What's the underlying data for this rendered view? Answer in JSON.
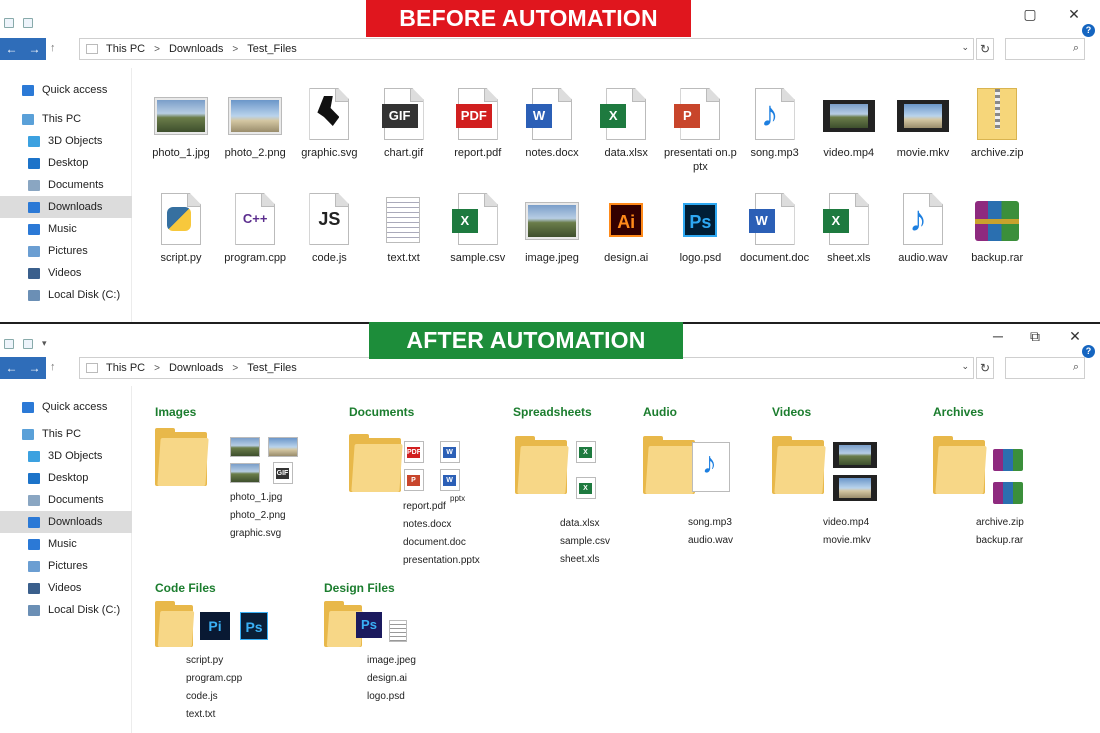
{
  "banners": {
    "before": "BEFORE AUTOMATION",
    "after": "AFTER AUTOMATION"
  },
  "window": {
    "help": "?",
    "minimize": "─",
    "maximize": "▢",
    "restore": "⧉",
    "close": "✕"
  },
  "nav": {
    "back": "←",
    "forward": "→",
    "up": "↑",
    "refresh": "↻",
    "search_icon": "⌕",
    "chevron": "⌄"
  },
  "breadcrumb": [
    "This PC",
    "Downloads",
    "Test_Files"
  ],
  "sidebar": [
    {
      "label": "Quick access",
      "icon": "star-icon",
      "color": "#2b79d6"
    },
    {
      "label": "This PC",
      "icon": "computer-icon",
      "color": "#5aa0d8"
    },
    {
      "label": "3D Objects",
      "icon": "cube-icon",
      "color": "#3ca1e0"
    },
    {
      "label": "Desktop",
      "icon": "desktop-icon",
      "color": "#1c73c9"
    },
    {
      "label": "Documents",
      "icon": "documents-icon",
      "color": "#8aa6c2"
    },
    {
      "label": "Downloads",
      "icon": "download-arrow-icon",
      "color": "#2b79d6"
    },
    {
      "label": "Music",
      "icon": "music-note-icon",
      "color": "#2b79d6"
    },
    {
      "label": "Pictures",
      "icon": "pictures-icon",
      "color": "#6b9ed2"
    },
    {
      "label": "Videos",
      "icon": "videos-icon",
      "color": "#3a5f8c"
    },
    {
      "label": "Local Disk (C:)",
      "icon": "disk-icon",
      "color": "#6b8fb5"
    }
  ],
  "before_files": [
    {
      "name": "photo_1.jpg",
      "kind": "land"
    },
    {
      "name": "photo_2.png",
      "kind": "sky"
    },
    {
      "name": "graphic.svg",
      "kind": "svg"
    },
    {
      "name": "chart.gif",
      "kind": "gif",
      "badge": "GIF",
      "color": "#333333"
    },
    {
      "name": "report.pdf",
      "kind": "badge",
      "badge": "PDF",
      "color": "#d11f1f"
    },
    {
      "name": "notes.docx",
      "kind": "badge",
      "badge": "W",
      "color": "#2b5fb6"
    },
    {
      "name": "data.xlsx",
      "kind": "badge",
      "badge": "X",
      "color": "#1e7a3f"
    },
    {
      "name": "presentati on.pptx",
      "kind": "badge",
      "badge": "P",
      "color": "#c8452b"
    },
    {
      "name": "song.mp3",
      "kind": "audio"
    },
    {
      "name": "video.mp4",
      "kind": "film"
    },
    {
      "name": "movie.mkv",
      "kind": "film2"
    },
    {
      "name": "archive.zip",
      "kind": "zip"
    },
    {
      "name": "script.py",
      "kind": "py"
    },
    {
      "name": "program.cpp",
      "kind": "cpp",
      "badge": "C++",
      "color": "#5b2d8e"
    },
    {
      "name": "code.js",
      "kind": "js",
      "badge": "JS",
      "color": "#222222"
    },
    {
      "name": "text.txt",
      "kind": "txt"
    },
    {
      "name": "sample.csv",
      "kind": "badge",
      "badge": "X",
      "color": "#1e7a3f"
    },
    {
      "name": "image.jpeg",
      "kind": "land"
    },
    {
      "name": "design.ai",
      "kind": "ai",
      "badge": "Ai",
      "color": "#ff8a1a"
    },
    {
      "name": "logo.psd",
      "kind": "ps",
      "badge": "Ps",
      "color": "#2ea8f2"
    },
    {
      "name": "document.doc",
      "kind": "badge",
      "badge": "W",
      "color": "#2b5fb6"
    },
    {
      "name": "sheet.xls",
      "kind": "badge",
      "badge": "X",
      "color": "#1e7a3f"
    },
    {
      "name": "audio.wav",
      "kind": "audio"
    },
    {
      "name": "backup.rar",
      "kind": "rar"
    }
  ],
  "groups": {
    "images": {
      "title": "Images",
      "files": [
        "photo_1.jpg",
        "photo_2.png",
        "graphic.svg"
      ]
    },
    "documents": {
      "title": "Documents",
      "files": [
        "report.pdf",
        "notes.docx",
        "document.doc",
        "presentation.pptx"
      ],
      "mini_badges": [
        "PDF",
        "W",
        "W"
      ],
      "pptx": "pptx"
    },
    "spreadsheets": {
      "title": "Spreadsheets",
      "files": [
        "data.xlsx",
        "sample.csv",
        "sheet.xls"
      ],
      "mini_badges": [
        "X",
        "X"
      ]
    },
    "audio": {
      "title": "Audio",
      "files": [
        "song.mp3",
        "audio.wav"
      ]
    },
    "videos": {
      "title": "Videos",
      "files": [
        "video.mp4",
        "movie.mkv"
      ]
    },
    "archives": {
      "title": "Archives",
      "files": [
        "archive.zip",
        "backup.rar"
      ]
    },
    "code": {
      "title": "Code Files",
      "files": [
        "script.py",
        "program.cpp",
        "code.js",
        "text.txt"
      ],
      "mini_badges": [
        "Pi",
        "Ps"
      ]
    },
    "design": {
      "title": "Design Files",
      "files": [
        "image.jpeg",
        "design.ai",
        "logo.psd"
      ],
      "mini_badges": [
        "Ps"
      ]
    }
  },
  "mini_thumb_label": "GIF"
}
